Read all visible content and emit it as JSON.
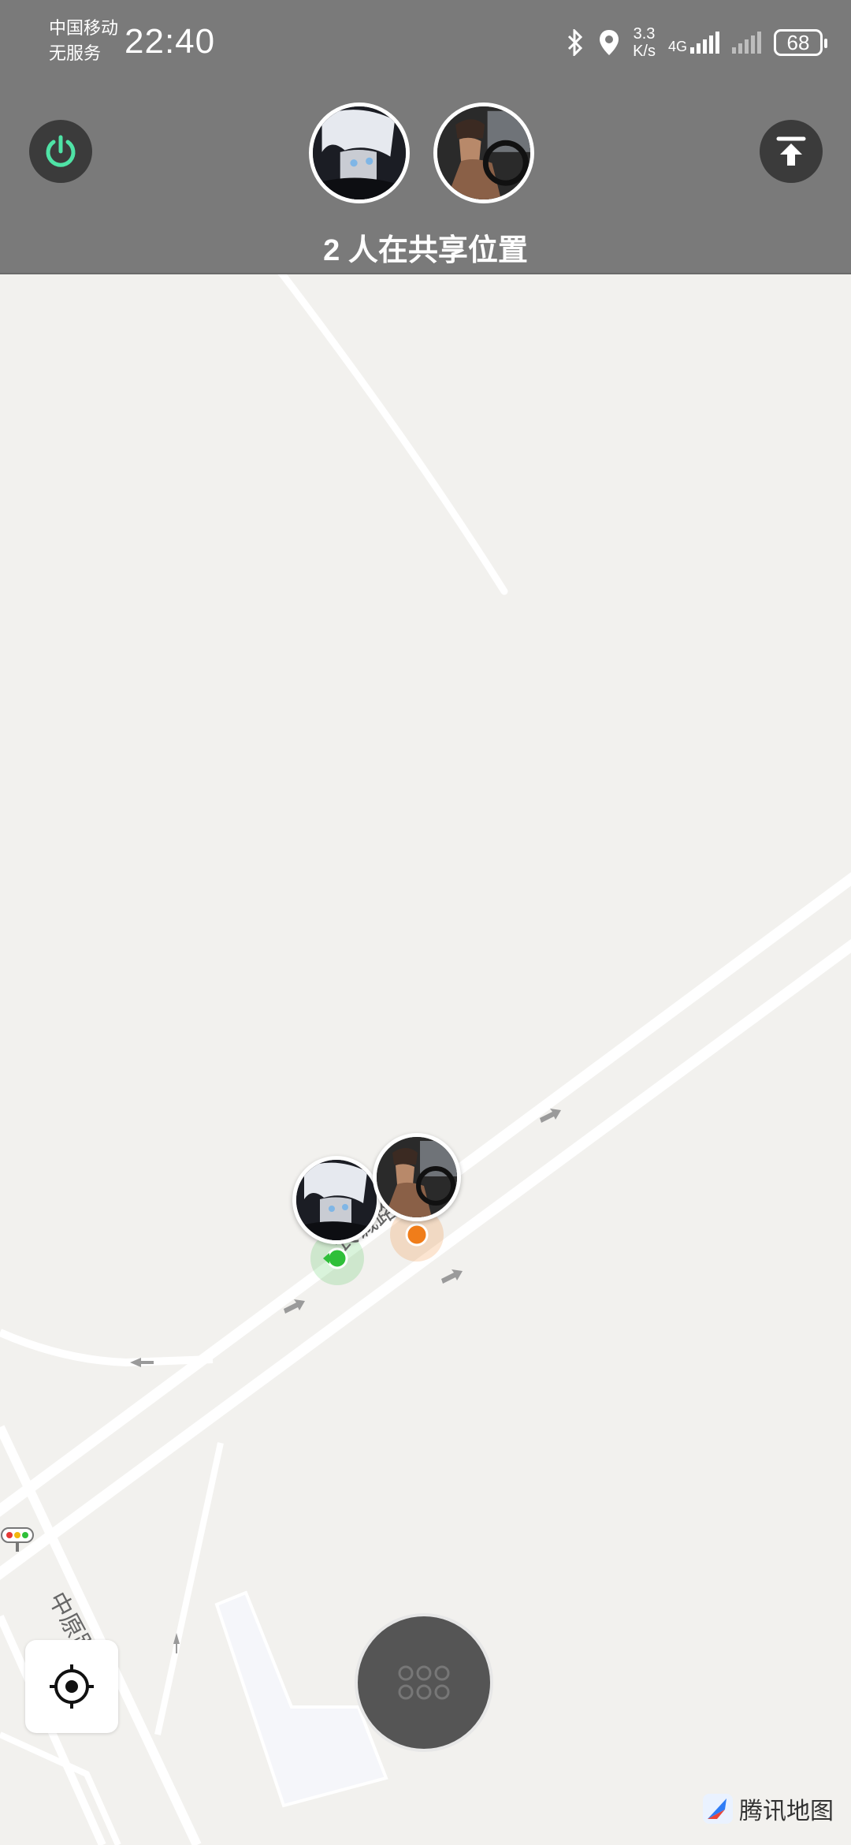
{
  "status_bar": {
    "carrier": "中国移动",
    "service": "无服务",
    "time": "22:40",
    "speed_value": "3.3",
    "speed_unit": "K/s",
    "network": "4G",
    "battery": "68"
  },
  "share": {
    "title": "2 人在共享位置"
  },
  "map": {
    "road_1": "长诚路",
    "road_2": "中原路",
    "provider": "腾讯地图"
  },
  "colors": {
    "overlay": "#7a7a7a",
    "map_bg": "#f2f1ee",
    "power_accent": "#4fe3a6",
    "me_dot": "#2fbf39",
    "friend_dot": "#f07d1a"
  },
  "icons": {
    "power": "power-icon",
    "upload": "upload-icon",
    "locate": "locate-icon",
    "menu": "grid-icon",
    "traffic": "traffic-light-icon"
  }
}
